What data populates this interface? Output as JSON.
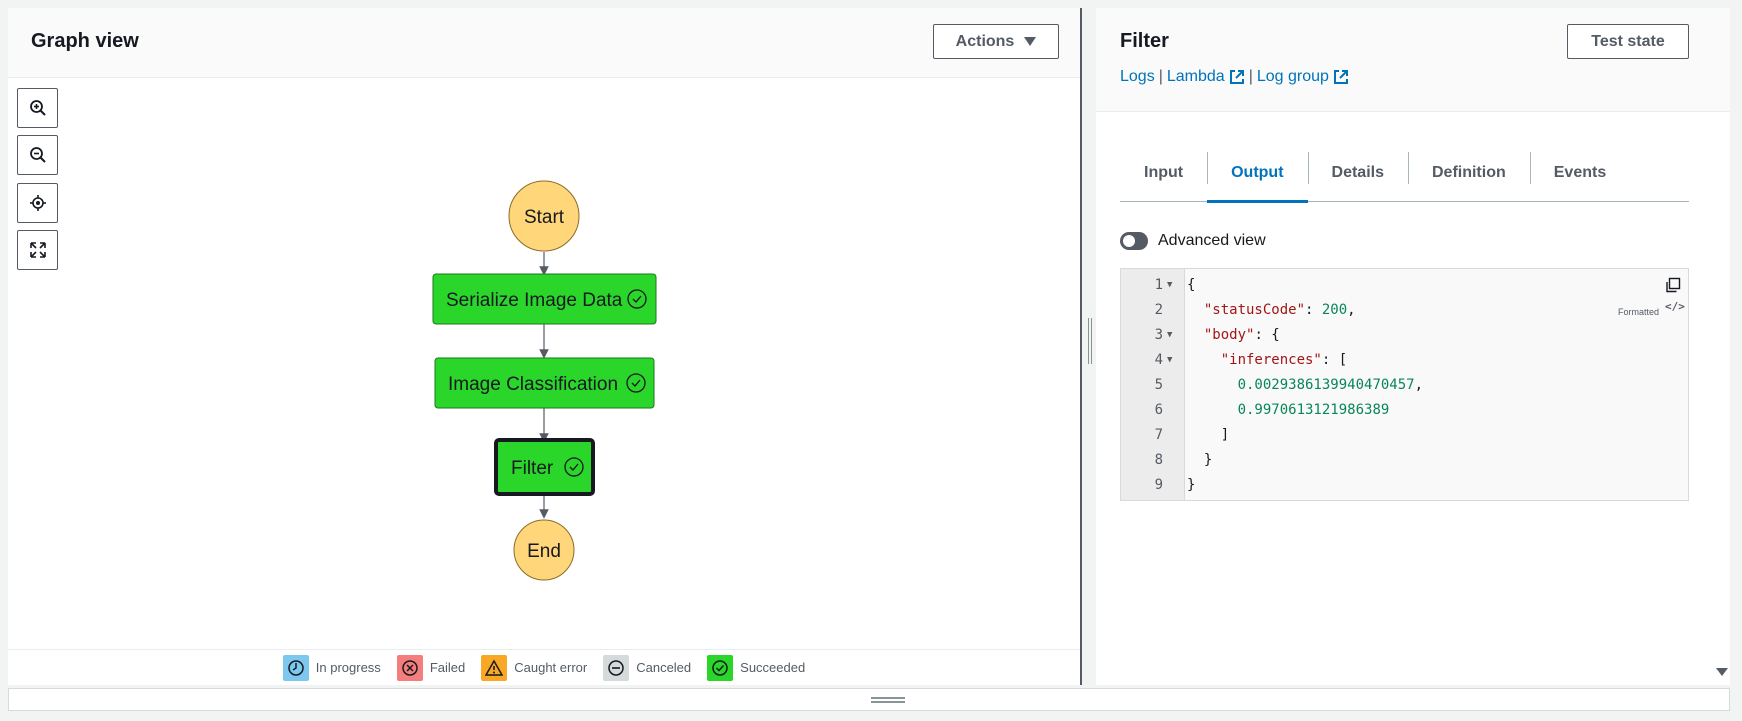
{
  "graph_panel": {
    "title": "Graph view",
    "actions_label": "Actions",
    "zoom_controls": [
      "zoom-in-icon",
      "zoom-out-icon",
      "center-icon",
      "fit-screen-icon"
    ],
    "nodes": [
      {
        "label": "Start",
        "kind": "terminal",
        "color": "#ffd67a"
      },
      {
        "label": "Serialize Image Data",
        "kind": "task",
        "status": "succeeded",
        "color": "#2bd62b"
      },
      {
        "label": "Image Classification",
        "kind": "task",
        "status": "succeeded",
        "color": "#2bd62b"
      },
      {
        "label": "Filter",
        "kind": "task",
        "status": "succeeded",
        "selected": true,
        "color": "#2bd62b"
      },
      {
        "label": "End",
        "kind": "terminal",
        "color": "#ffd67a"
      }
    ],
    "legend": [
      {
        "label": "In progress",
        "icon": "clock-icon",
        "color": "#7dc8ee"
      },
      {
        "label": "Failed",
        "icon": "x-circle-icon",
        "color": "#f47e7e"
      },
      {
        "label": "Caught error",
        "icon": "warning-icon",
        "color": "#f9a825"
      },
      {
        "label": "Canceled",
        "icon": "minus-circle-icon",
        "color": "#d5dbdb"
      },
      {
        "label": "Succeeded",
        "icon": "check-circle-icon",
        "color": "#2bd62b"
      }
    ]
  },
  "detail_panel": {
    "title": "Filter",
    "test_state_label": "Test state",
    "links": {
      "logs": "Logs",
      "separator": "|",
      "lambda": "Lambda",
      "log_group": "Log group"
    },
    "tabs": [
      {
        "label": "Input",
        "active": false
      },
      {
        "label": "Output",
        "active": true
      },
      {
        "label": "Details",
        "active": false
      },
      {
        "label": "Definition",
        "active": false
      },
      {
        "label": "Events",
        "active": false
      }
    ],
    "advanced_view_label": "Advanced view",
    "formatted_label": "Formatted",
    "code_lines": [
      {
        "n": "1",
        "fold": true
      },
      {
        "n": "2",
        "fold": false
      },
      {
        "n": "3",
        "fold": true
      },
      {
        "n": "4",
        "fold": true
      },
      {
        "n": "5",
        "fold": false
      },
      {
        "n": "6",
        "fold": false
      },
      {
        "n": "7",
        "fold": false
      },
      {
        "n": "8",
        "fold": false
      },
      {
        "n": "9",
        "fold": false
      }
    ],
    "output": {
      "statusCode_key": "\"statusCode\"",
      "statusCode": "200",
      "body_key": "\"body\"",
      "inferences_key": "\"inferences\"",
      "inference_0": "0.0029386139940470457",
      "inference_1": "0.9970613121986389"
    }
  },
  "colors": {
    "link": "#0073bb",
    "succeeded": "#2bd62b",
    "terminal": "#ffd67a"
  }
}
